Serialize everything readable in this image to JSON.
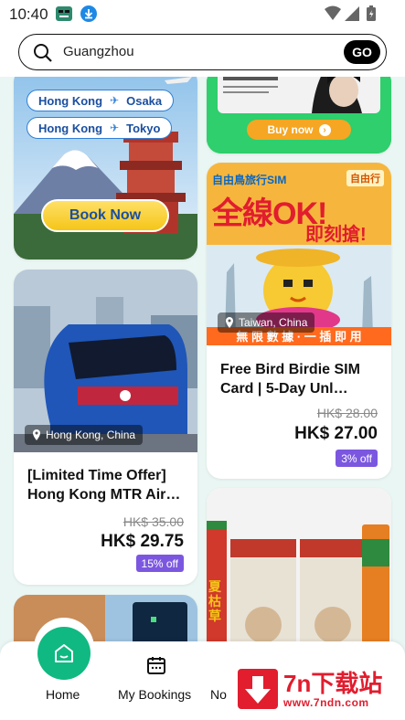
{
  "status_bar": {
    "time": "10:40"
  },
  "search": {
    "value": "Guangzhou",
    "go_label": "GO"
  },
  "cards": {
    "flight_promo": {
      "routes": [
        {
          "from": "Hong Kong",
          "to": "Osaka"
        },
        {
          "from": "Hong Kong",
          "to": "Tokyo"
        }
      ],
      "cta": "Book Now"
    },
    "top_right_promo": {
      "cta": "Buy now"
    },
    "sim_card": {
      "banner_title": "全線OK!",
      "banner_subtitle": "即刻搶!",
      "banner_tag": "自由鳥旅行SIM",
      "brand": "自由行",
      "banner_footer": "無 限 數 據 · 一 插 即 用",
      "location": "Taiwan, China",
      "title": "Free Bird Birdie SIM Card | 5-Day Unl…",
      "old_price": "HK$ 28.00",
      "price": "HK$ 27.00",
      "discount": "3% off"
    },
    "mtr": {
      "location": "Hong Kong, China",
      "title": "[Limited Time Offer] Hong Kong MTR Air…",
      "old_price": "HK$ 35.00",
      "price": "HK$ 29.75",
      "discount": "15% off"
    },
    "drinks_product": {
      "can_label": "夏枯草"
    }
  },
  "bottom_nav": {
    "items": [
      {
        "label": "Home",
        "icon": "home-icon"
      },
      {
        "label": "My Bookings",
        "icon": "calendar-icon"
      },
      {
        "label": "No",
        "icon": "notification-icon"
      }
    ]
  },
  "watermark": {
    "brand": "7n下载站",
    "url": "www.7ndn.com"
  },
  "colors": {
    "accent": "#10b981",
    "discount": "#7b57e0",
    "cta_yellow": "#f5c518"
  }
}
